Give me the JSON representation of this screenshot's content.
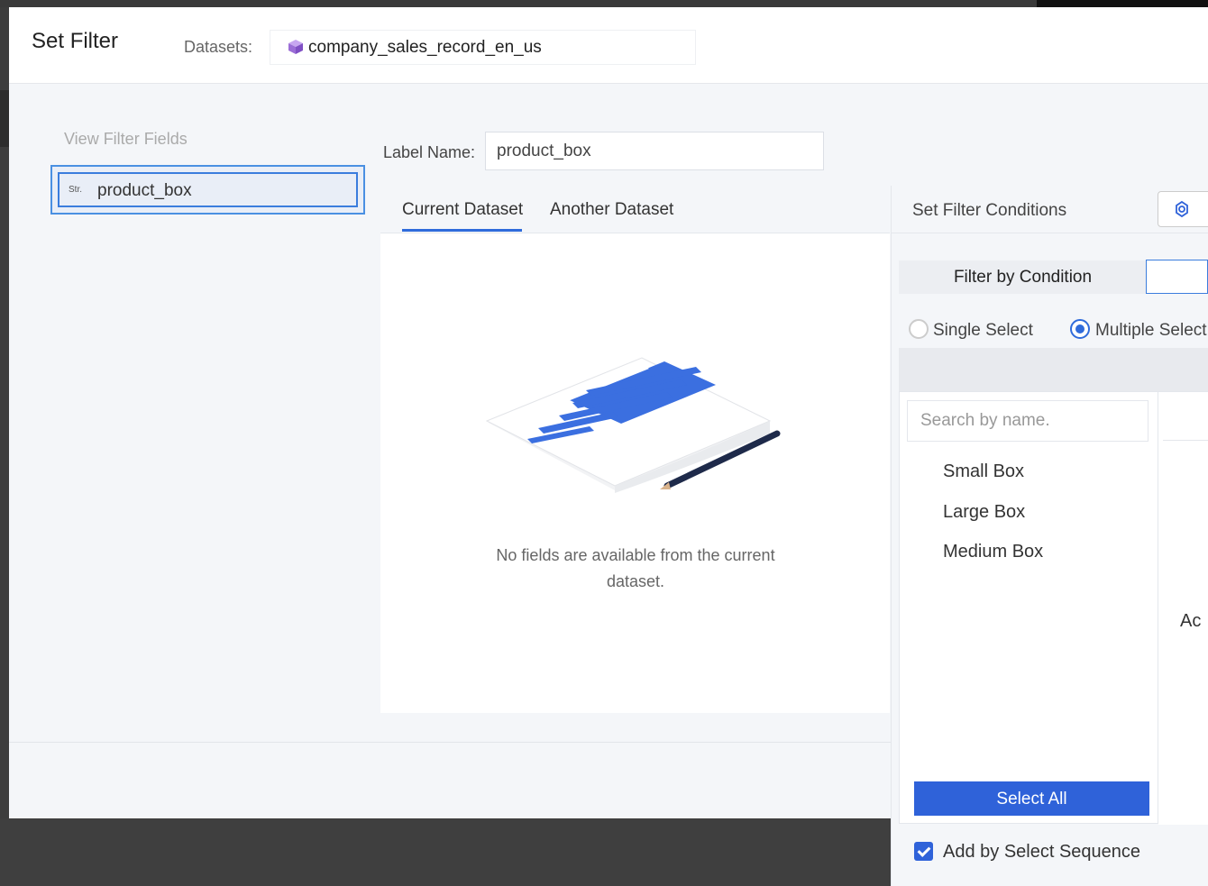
{
  "dialog": {
    "title": "Set Filter",
    "datasets_label": "Datasets:",
    "dataset_name": "company_sales_record_en_us"
  },
  "left": {
    "view_filter_fields": "View Filter Fields",
    "field_type": "Str.",
    "field_name": "product_box"
  },
  "label": {
    "label_name": "Label Name:",
    "value": "product_box"
  },
  "tabs": [
    {
      "label": "Current Dataset",
      "active": true
    },
    {
      "label": "Another Dataset",
      "active": false
    }
  ],
  "empty_state": {
    "message": "No fields are available from the current dataset."
  },
  "conditions": {
    "title": "Set Filter Conditions",
    "filter_by": "Filter by Condition",
    "single_select": "Single Select",
    "multiple_select": "Multiple Select",
    "selected_mode": "multiple",
    "search_placeholder": "Search by name.",
    "options": [
      "Small Box",
      "Large Box",
      "Medium Box"
    ],
    "partial_text": "Ac",
    "select_all": "Select All",
    "add_by_sequence": "Add by Select Sequence",
    "add_by_sequence_checked": true
  },
  "colors": {
    "accent": "#2f62d9",
    "highlight": "#3b7ddd",
    "dataset_icon": "#9b6dd6"
  },
  "icons": {
    "dataset": "cube-icon",
    "settings": "settings-icon",
    "empty_illustration": "document-pencil-illustration"
  }
}
